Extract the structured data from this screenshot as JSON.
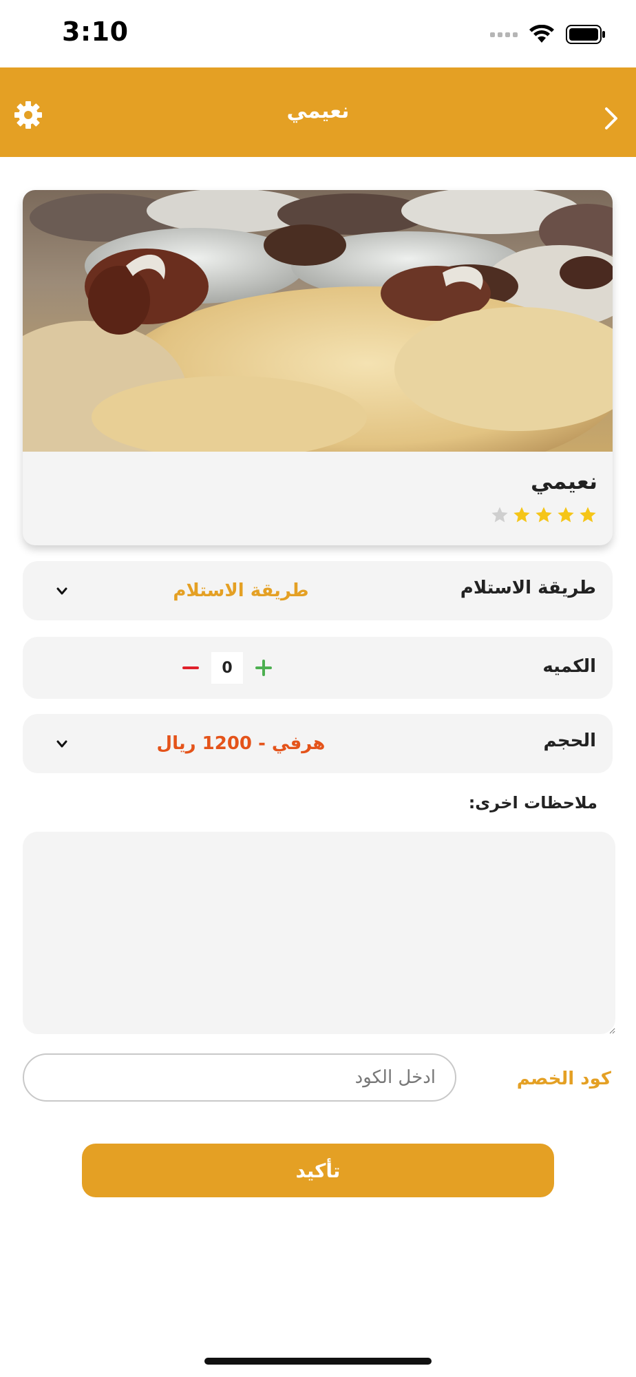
{
  "status_bar": {
    "time": "3:10",
    "icons": [
      "signal-dots-icon",
      "wifi-icon",
      "battery-icon"
    ]
  },
  "header": {
    "title": "نعيمي",
    "left_icon": "gear-icon",
    "right_icon": "chevron-right-icon"
  },
  "product": {
    "name": "نعيمي",
    "rating": 4,
    "rating_max": 5,
    "image": "sheep-flock-photo"
  },
  "fields": {
    "delivery": {
      "label": "طريقة الاستلام",
      "value": "طريقة الاستلام"
    },
    "quantity": {
      "label": "الكميه",
      "value": "0"
    },
    "size": {
      "label": "الحجم",
      "value": "هرفي - 1200 ريال"
    }
  },
  "notes": {
    "label": "ملاحظات اخرى:"
  },
  "coupon": {
    "label": "كود الخصم",
    "placeholder": "ادخل الكود"
  },
  "confirm_label": "تأكيد",
  "colors": {
    "accent": "#E4A024",
    "size_value": "#E4531A",
    "plus": "#4caf50",
    "minus": "#e0202a",
    "star_on": "#F5C518",
    "star_off": "#cfcfcf"
  }
}
